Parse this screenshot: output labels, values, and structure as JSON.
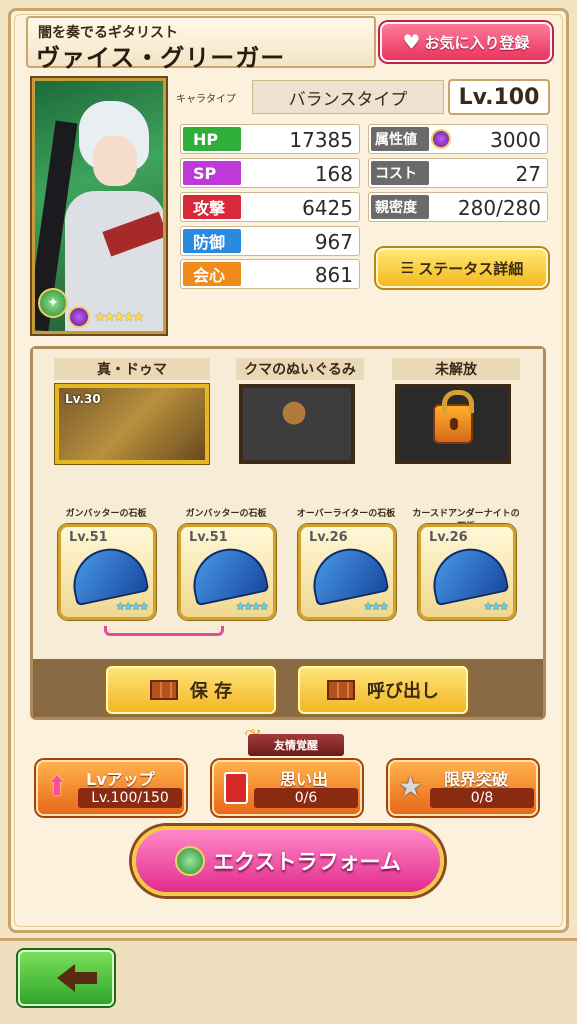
{
  "header": {
    "subtitle": "闇を奏でるギタリスト",
    "name": "ヴァイス・グリーガー",
    "favorite_label": "お気に入り登録"
  },
  "character": {
    "type_label": "キャラタイプ",
    "type_value": "バランスタイプ",
    "level": "Lv.100",
    "rarity_stars": "★★★★★"
  },
  "stats": {
    "hp": {
      "label": "HP",
      "value": "17385"
    },
    "sp": {
      "label": "SP",
      "value": "168"
    },
    "atk": {
      "label": "攻撃",
      "value": "6425"
    },
    "def": {
      "label": "防御",
      "value": "967"
    },
    "crit": {
      "label": "会心",
      "value": "861"
    },
    "attr": {
      "label": "属性値",
      "value": "3000"
    },
    "cost": {
      "label": "コスト",
      "value": "27"
    },
    "affinity": {
      "label": "親密度",
      "value": "280/280"
    }
  },
  "status_detail_label": "ステータス詳細",
  "equipment": {
    "weapon": {
      "title": "真・ドゥマ",
      "level": "Lv.30"
    },
    "accessory": {
      "title": "クマのぬいぐるみ"
    },
    "locked": {
      "title": "未解放"
    }
  },
  "tablets": [
    {
      "title": "ガンバッターの石板",
      "level": "Lv.51",
      "stars": "★★★★"
    },
    {
      "title": "ガンバッターの石板",
      "level": "Lv.51",
      "stars": "★★★★"
    },
    {
      "title": "オーバーライターの石板",
      "level": "Lv.26",
      "stars": "★★★"
    },
    {
      "title": "カースドアンダーナイトの石板",
      "level": "Lv.26",
      "stars": "★★★"
    }
  ],
  "save_label": "保 存",
  "load_label": "呼び出し",
  "actions": {
    "levelup": {
      "label": "Lvアップ",
      "sub": "Lv.100/150"
    },
    "memory": {
      "badge": "友情覚醒",
      "label": "思い出",
      "sub": "0/6"
    },
    "limit": {
      "label": "限界突破",
      "sub": "0/8"
    }
  },
  "extra_form_label": "エクストラフォーム"
}
